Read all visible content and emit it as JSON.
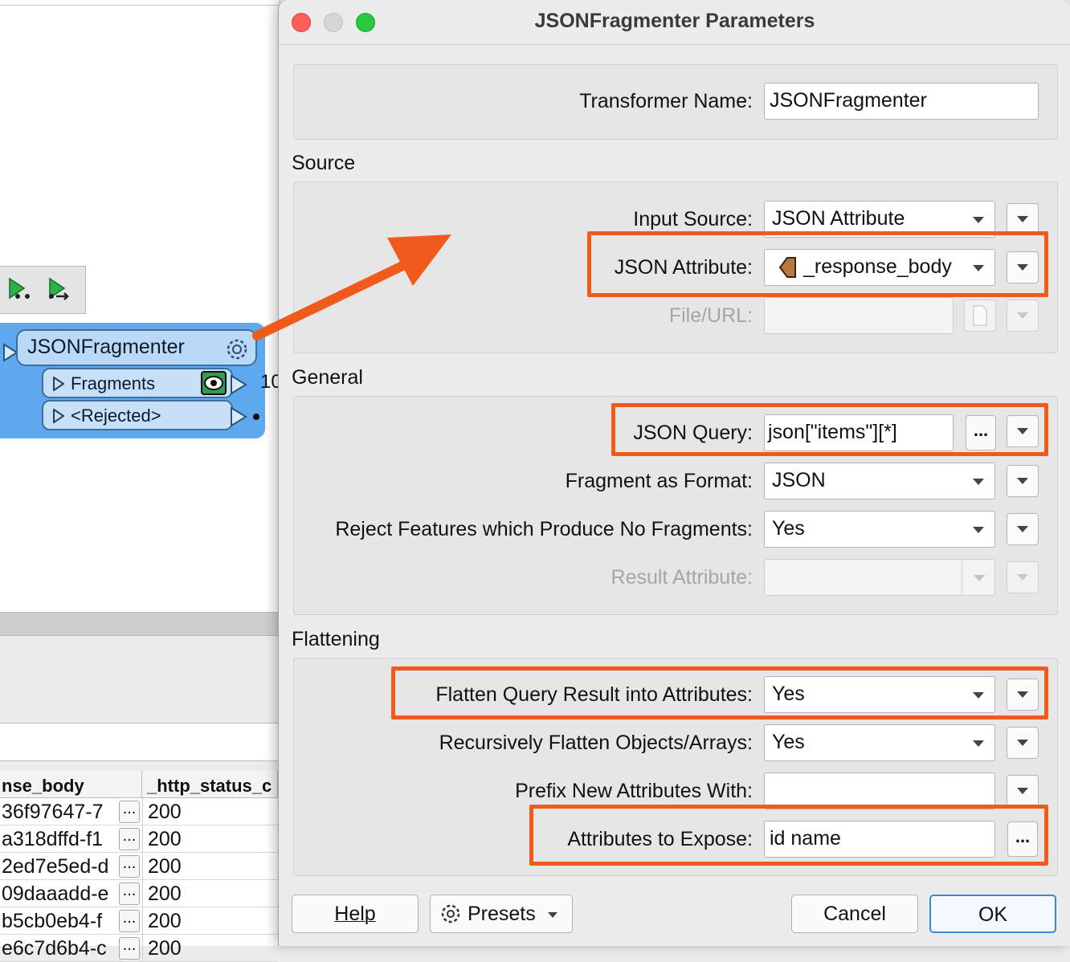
{
  "background": {
    "transformer": {
      "name": "JSONFragmenter",
      "ports": [
        "Fragments",
        "<Rejected>"
      ],
      "feature_count": "10"
    },
    "table": {
      "headers": [
        "nse_body",
        "_http_status_c"
      ],
      "rows": [
        {
          "body": "36f97647-7",
          "status": "200"
        },
        {
          "body": "a318dffd-f1",
          "status": "200"
        },
        {
          "body": "2ed7e5ed-d",
          "status": "200"
        },
        {
          "body": "09daaadd-e",
          "status": "200"
        },
        {
          "body": "b5cb0eb4-f",
          "status": "200"
        },
        {
          "body": "e6c7d6b4-c",
          "status": "200"
        }
      ],
      "ellipsis": "..."
    }
  },
  "dialog": {
    "title": "JSONFragmenter Parameters",
    "transformer_name": {
      "label": "Transformer Name:",
      "value": "JSONFragmenter"
    },
    "source": {
      "title": "Source",
      "input_source": {
        "label": "Input Source:",
        "value": "JSON Attribute"
      },
      "json_attribute": {
        "label": "JSON Attribute:",
        "value": "_response_body"
      },
      "file_url": {
        "label": "File/URL:",
        "value": ""
      }
    },
    "general": {
      "title": "General",
      "json_query": {
        "label": "JSON Query:",
        "value": "json[\"items\"][*]"
      },
      "fragment_format": {
        "label": "Fragment as Format:",
        "value": "JSON"
      },
      "reject_no_fragments": {
        "label": "Reject Features which Produce No Fragments:",
        "value": "Yes"
      },
      "result_attribute": {
        "label": "Result Attribute:",
        "value": ""
      }
    },
    "flattening": {
      "title": "Flattening",
      "flatten_query": {
        "label": "Flatten Query Result into Attributes:",
        "value": "Yes"
      },
      "recursive_flatten": {
        "label": "Recursively Flatten Objects/Arrays:",
        "value": "Yes"
      },
      "prefix": {
        "label": "Prefix New Attributes With:",
        "value": ""
      },
      "expose": {
        "label": "Attributes to Expose:",
        "value": "id name"
      }
    },
    "buttons": {
      "help": "Help",
      "presets": "Presets",
      "cancel": "Cancel",
      "ok": "OK"
    },
    "ellipsis": "...",
    "highlight_color": "#f05a1a"
  }
}
